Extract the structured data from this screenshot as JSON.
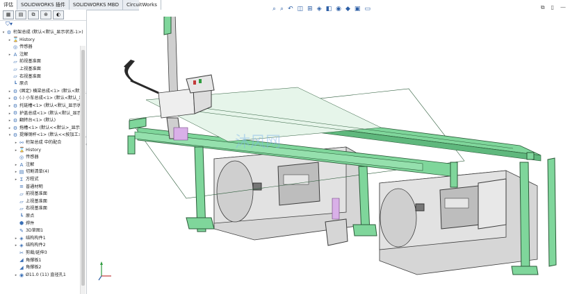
{
  "tabs": [
    "评估",
    "SOLIDWORKS 插件",
    "SOLIDWORKS MBD",
    "CircuitWorks"
  ],
  "manager_tabs": [
    "feature-tree-icon",
    "property-manager-icon",
    "config-manager-icon",
    "dimxpert-icon",
    "display-manager-icon"
  ],
  "filter_icon": "filter-icon",
  "tree": [
    {
      "label": "桁架总成 (默认<默认_显示状态-1>)",
      "indent": 0,
      "icon": "assembly-icon",
      "expand": "▾"
    },
    {
      "label": "History",
      "indent": 1,
      "icon": "history-icon",
      "expand": "▸"
    },
    {
      "label": "传感器",
      "indent": 1,
      "icon": "sensor-icon",
      "expand": ""
    },
    {
      "label": "注解",
      "indent": 1,
      "icon": "annotation-icon",
      "expand": "▸"
    },
    {
      "label": "前视基准面",
      "indent": 1,
      "icon": "plane-icon",
      "expand": ""
    },
    {
      "label": "上视基准面",
      "indent": 1,
      "icon": "plane-icon",
      "expand": ""
    },
    {
      "label": "右视基准面",
      "indent": 1,
      "icon": "plane-icon",
      "expand": ""
    },
    {
      "label": "原点",
      "indent": 1,
      "icon": "origin-icon",
      "expand": ""
    },
    {
      "label": "(固定) 横梁总成<1> (默认<默认_显",
      "indent": 1,
      "icon": "assembly-icon",
      "expand": "▸"
    },
    {
      "label": "(-) 小车总成<1> (默认<默认_显",
      "indent": 1,
      "icon": "assembly-icon",
      "expand": "▸"
    },
    {
      "label": "托链槽<1> (默认<默认_显示状",
      "indent": 1,
      "icon": "assembly-icon",
      "expand": "▸"
    },
    {
      "label": "护盖总成<1> (默认<默认_显示状",
      "indent": 1,
      "icon": "assembly-icon",
      "expand": "▸"
    },
    {
      "label": "翻转台<1> (默认)",
      "indent": 1,
      "icon": "assembly-icon",
      "expand": "▸"
    },
    {
      "label": "拖槽<1> (默认<<默认>_显示状",
      "indent": 1,
      "icon": "assembly-icon",
      "expand": "▸"
    },
    {
      "label": "提爆钢杆<1> (默认<<按加工>>_",
      "indent": 1,
      "icon": "assembly-icon",
      "expand": "▾"
    },
    {
      "label": "桁架总成 中的配合",
      "indent": 2,
      "icon": "mate-icon",
      "expand": "▸"
    },
    {
      "label": "History",
      "indent": 2,
      "icon": "history-icon",
      "expand": "▸"
    },
    {
      "label": "传感器",
      "indent": 2,
      "icon": "sensor-icon",
      "expand": ""
    },
    {
      "label": "注解",
      "indent": 2,
      "icon": "annotation-icon",
      "expand": "▸"
    },
    {
      "label": "切割清单(4)",
      "indent": 2,
      "icon": "cutlist-icon",
      "expand": "▸"
    },
    {
      "label": "方程式",
      "indent": 2,
      "icon": "equation-icon",
      "expand": "▸"
    },
    {
      "label": "普通材明",
      "indent": 2,
      "icon": "material-icon",
      "expand": ""
    },
    {
      "label": "前视基准面",
      "indent": 2,
      "icon": "plane-icon",
      "expand": ""
    },
    {
      "label": "上视基准面",
      "indent": 2,
      "icon": "plane-icon",
      "expand": ""
    },
    {
      "label": "右视基准面",
      "indent": 2,
      "icon": "plane-icon",
      "expand": ""
    },
    {
      "label": "原点",
      "indent": 2,
      "icon": "origin-icon",
      "expand": ""
    },
    {
      "label": "焊件",
      "indent": 2,
      "icon": "weldment-icon",
      "expand": ""
    },
    {
      "label": "3D草图1",
      "indent": 2,
      "icon": "sketch3d-icon",
      "expand": ""
    },
    {
      "label": "结构构件1",
      "indent": 2,
      "icon": "structural-icon",
      "expand": "▸"
    },
    {
      "label": "结构构件2",
      "indent": 2,
      "icon": "structural-icon",
      "expand": "▸"
    },
    {
      "label": "剪裁/延伸3",
      "indent": 2,
      "icon": "trim-icon",
      "expand": ""
    },
    {
      "label": "角撑板1",
      "indent": 2,
      "icon": "gusset-icon",
      "expand": ""
    },
    {
      "label": "角撑板2",
      "indent": 2,
      "icon": "gusset-icon",
      "expand": ""
    },
    {
      "label": "Ø11.0 (11) 直径孔1",
      "indent": 2,
      "icon": "hole-icon",
      "expand": "▸"
    }
  ],
  "view_toolbar": [
    "zoom-fit-icon",
    "zoom-area-icon",
    "previous-view-icon",
    "section-view-icon",
    "dynamic-annotation-icon",
    "view-orientation-icon",
    "display-style-icon",
    "hide-show-icon",
    "edit-appearance-icon",
    "apply-scene-icon",
    "view-settings-icon"
  ],
  "window_controls": [
    "restore-icon",
    "tile-icon",
    "minimize-icon"
  ],
  "watermark": "沐风网",
  "colors": {
    "frame_green": "#7fd69b",
    "frame_edge": "#2a5a38",
    "machine_gray": "#d4d4d4",
    "machine_edge": "#3c3c3c",
    "accent_blue": "#2d5fa6"
  }
}
